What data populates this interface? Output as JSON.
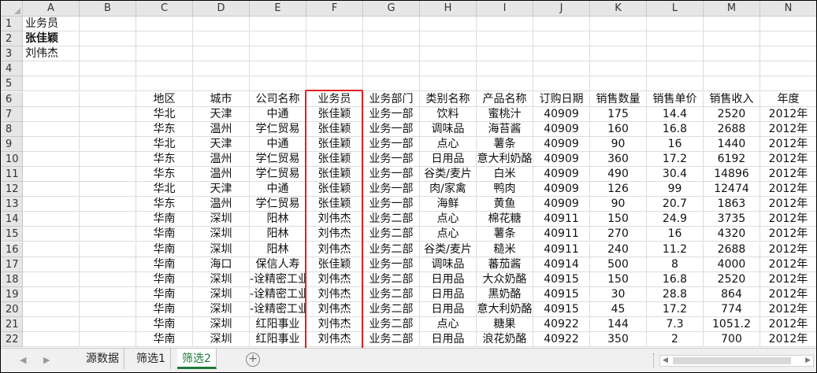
{
  "columns": [
    "A",
    "B",
    "C",
    "D",
    "E",
    "F",
    "G",
    "H",
    "I",
    "J",
    "K",
    "L",
    "M",
    "N"
  ],
  "rows": [
    "1",
    "2",
    "3",
    "4",
    "5",
    "6",
    "7",
    "8",
    "9",
    "10",
    "11",
    "12",
    "13",
    "14",
    "15",
    "16",
    "17",
    "18",
    "19",
    "20",
    "21",
    "22"
  ],
  "criteria": {
    "a1": "业务员",
    "a2": "张佳颖",
    "a3": "刘伟杰"
  },
  "table": {
    "headers": [
      "地区",
      "城市",
      "公司名称",
      "业务员",
      "业务部门",
      "类别名称",
      "产品名称",
      "订购日期",
      "销售数量",
      "销售单价",
      "销售收入",
      "年度"
    ],
    "rows": [
      [
        "华北",
        "天津",
        "中通",
        "张佳颖",
        "业务一部",
        "饮料",
        "蜜桃汁",
        "40909",
        "175",
        "14.4",
        "2520",
        "2012年"
      ],
      [
        "华东",
        "温州",
        "学仁贸易",
        "张佳颖",
        "业务一部",
        "调味品",
        "海苔酱",
        "40909",
        "160",
        "16.8",
        "2688",
        "2012年"
      ],
      [
        "华北",
        "天津",
        "中通",
        "张佳颖",
        "业务一部",
        "点心",
        "薯条",
        "40909",
        "90",
        "16",
        "1440",
        "2012年"
      ],
      [
        "华东",
        "温州",
        "学仁贸易",
        "张佳颖",
        "业务一部",
        "日用品",
        "意大利奶酪",
        "40909",
        "360",
        "17.2",
        "6192",
        "2012年"
      ],
      [
        "华东",
        "温州",
        "学仁贸易",
        "张佳颖",
        "业务一部",
        "谷类/麦片",
        "白米",
        "40909",
        "490",
        "30.4",
        "14896",
        "2012年"
      ],
      [
        "华北",
        "天津",
        "中通",
        "张佳颖",
        "业务一部",
        "肉/家禽",
        "鸭肉",
        "40909",
        "126",
        "99",
        "12474",
        "2012年"
      ],
      [
        "华东",
        "温州",
        "学仁贸易",
        "张佳颖",
        "业务一部",
        "海鲜",
        "黄鱼",
        "40909",
        "90",
        "20.7",
        "1863",
        "2012年"
      ],
      [
        "华南",
        "深圳",
        "阳林",
        "刘伟杰",
        "业务二部",
        "点心",
        "棉花糖",
        "40911",
        "150",
        "24.9",
        "3735",
        "2012年"
      ],
      [
        "华南",
        "深圳",
        "阳林",
        "刘伟杰",
        "业务二部",
        "点心",
        "薯条",
        "40911",
        "270",
        "16",
        "4320",
        "2012年"
      ],
      [
        "华南",
        "深圳",
        "阳林",
        "刘伟杰",
        "业务二部",
        "谷类/麦片",
        "糙米",
        "40911",
        "240",
        "11.2",
        "2688",
        "2012年"
      ],
      [
        "华南",
        "海口",
        "保信人寿",
        "张佳颖",
        "业务一部",
        "调味品",
        "蕃茄酱",
        "40914",
        "500",
        "8",
        "4000",
        "2012年"
      ],
      [
        "华南",
        "深圳",
        "-诠精密工业",
        "刘伟杰",
        "业务二部",
        "日用品",
        "大众奶酪",
        "40915",
        "150",
        "16.8",
        "2520",
        "2012年"
      ],
      [
        "华南",
        "深圳",
        "-诠精密工业",
        "刘伟杰",
        "业务二部",
        "日用品",
        "黑奶酪",
        "40915",
        "30",
        "28.8",
        "864",
        "2012年"
      ],
      [
        "华南",
        "深圳",
        "-诠精密工业",
        "刘伟杰",
        "业务二部",
        "日用品",
        "意大利奶酪",
        "40915",
        "45",
        "17.2",
        "774",
        "2012年"
      ],
      [
        "华南",
        "深圳",
        "红阳事业",
        "刘伟杰",
        "业务二部",
        "点心",
        "糖果",
        "40922",
        "144",
        "7.3",
        "1051.2",
        "2012年"
      ],
      [
        "华南",
        "深圳",
        "红阳事业",
        "刘伟杰",
        "业务二部",
        "日用品",
        "浪花奶酪",
        "40922",
        "350",
        "2",
        "700",
        "2012年"
      ]
    ]
  },
  "sheet_tabs": [
    "源数据",
    "筛选1",
    "筛选2"
  ],
  "active_tab": "筛选2",
  "add_sheet_label": "+",
  "highlight_color": "#e02020",
  "active_tab_color": "#1d7a3a"
}
